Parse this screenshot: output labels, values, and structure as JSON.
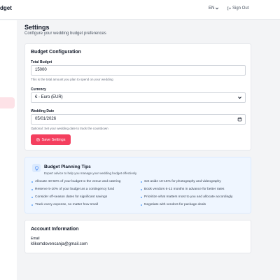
{
  "app": {
    "brand_fragment": "dget"
  },
  "header": {
    "language": "EN",
    "sign_out": "Sign Out"
  },
  "page": {
    "title": "Settings",
    "subtitle": "Configure your wedding budget preferences"
  },
  "budget_config": {
    "title": "Budget Configuration",
    "total_budget": {
      "label": "Total Budget",
      "value": "15000",
      "hint": "This is the total amount you plan to spend on your wedding"
    },
    "currency": {
      "label": "Currency",
      "value": "€ - Euro (EUR)"
    },
    "wedding_date": {
      "label": "Wedding Date",
      "value": "05/01/2026",
      "hint": "Optional: Set your wedding date to track the countdown"
    },
    "save_label": "Save Settings"
  },
  "tips": {
    "title": "Budget Planning Tips",
    "subtitle": "Expert advice to help you manage your wedding budget effectively",
    "left": [
      "Allocate 40-50% of your budget to the venue and catering",
      "Reserve 5-10% of your budget as a contingency fund",
      "Consider off-season dates for significant savings",
      "Track every expense, no matter how small"
    ],
    "right": [
      "Set aside 10-15% for photography and videography",
      "Book vendors 6-12 months in advance for better rates",
      "Prioritize what matters most to you and allocate accordingly",
      "Negotiate with vendors for package deals"
    ]
  },
  "account": {
    "title": "Account Information",
    "email_label": "Email",
    "email_value": "klikomdovencanja@gmail.com"
  },
  "colors": {
    "accent": "#f43f5e",
    "tips_bg": "#eff6ff",
    "tip_bullet": "#60a5fa"
  },
  "icons": {
    "language_chevron": "chevron-down-icon",
    "sign_out": "sign-out-icon",
    "select_chevron": "chevron-down-icon",
    "calendar": "calendar-icon",
    "save": "save-icon",
    "tips": "lightbulb-icon"
  }
}
